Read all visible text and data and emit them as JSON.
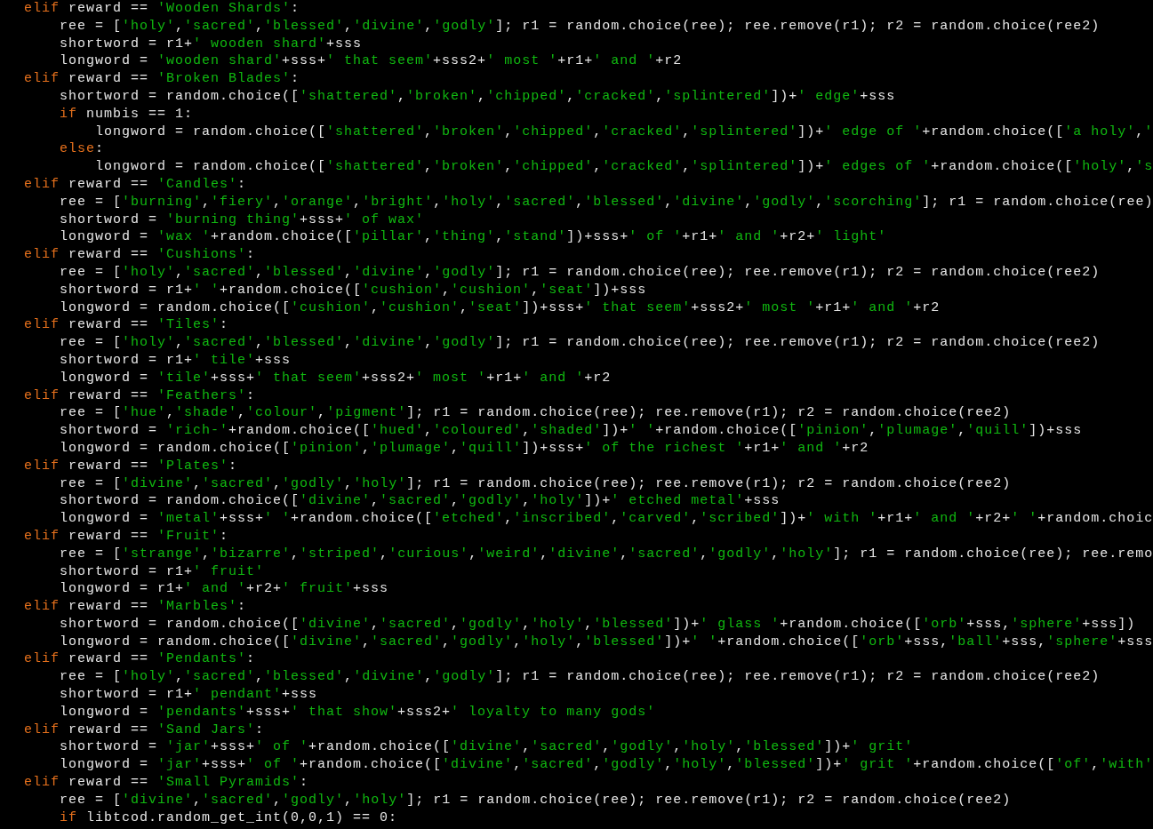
{
  "lines": [
    {
      "text": "elif reward == 'Wooden Shards':",
      "keyword": true
    },
    {
      "text": "    ree = ['holy','sacred','blessed','divine','godly']; r1 = random.choice(ree); ree.remove(r1); r2 = random.choice(ree2)",
      "keyword": false
    },
    {
      "text": "    shortword = r1+' wooden shard'+sss",
      "keyword": false
    },
    {
      "text": "    longword = 'wooden shard'+sss+' that seem'+sss2+' most '+r1+' and '+r2",
      "keyword": false
    },
    {
      "text": "elif reward == 'Broken Blades':",
      "keyword": true
    },
    {
      "text": "    shortword = random.choice(['shattered','broken','chipped','cracked','splintered'])+' edge'+sss",
      "keyword": false
    },
    {
      "text": "    if numbis == 1:",
      "keyword": true
    },
    {
      "text": "        longword = random.choice(['shattered','broken','chipped','cracked','splintered'])+' edge of '+random.choice(['a holy','",
      "keyword": false
    },
    {
      "text": "    else:",
      "keyword": true
    },
    {
      "text": "        longword = random.choice(['shattered','broken','chipped','cracked','splintered'])+' edges of '+random.choice(['holy','s",
      "keyword": false
    },
    {
      "text": "elif reward == 'Candles':",
      "keyword": true
    },
    {
      "text": "    ree = ['burning','fiery','orange','bright','holy','sacred','blessed','divine','godly','scorching']; r1 = random.choice(ree)",
      "keyword": false
    },
    {
      "text": "    shortword = 'burning thing'+sss+' of wax'",
      "keyword": false
    },
    {
      "text": "    longword = 'wax '+random.choice(['pillar','thing','stand'])+sss+' of '+r1+' and '+r2+' light'",
      "keyword": false
    },
    {
      "text": "elif reward == 'Cushions':",
      "keyword": true
    },
    {
      "text": "    ree = ['holy','sacred','blessed','divine','godly']; r1 = random.choice(ree); ree.remove(r1); r2 = random.choice(ree2)",
      "keyword": false
    },
    {
      "text": "    shortword = r1+' '+random.choice(['cushion','cushion','seat'])+sss",
      "keyword": false
    },
    {
      "text": "    longword = random.choice(['cushion','cushion','seat'])+sss+' that seem'+sss2+' most '+r1+' and '+r2",
      "keyword": false
    },
    {
      "text": "elif reward == 'Tiles':",
      "keyword": true
    },
    {
      "text": "    ree = ['holy','sacred','blessed','divine','godly']; r1 = random.choice(ree); ree.remove(r1); r2 = random.choice(ree2)",
      "keyword": false
    },
    {
      "text": "    shortword = r1+' tile'+sss",
      "keyword": false
    },
    {
      "text": "    longword = 'tile'+sss+' that seem'+sss2+' most '+r1+' and '+r2",
      "keyword": false
    },
    {
      "text": "elif reward == 'Feathers':",
      "keyword": true
    },
    {
      "text": "    ree = ['hue','shade','colour','pigment']; r1 = random.choice(ree); ree.remove(r1); r2 = random.choice(ree2)",
      "keyword": false
    },
    {
      "text": "    shortword = 'rich-'+random.choice(['hued','coloured','shaded'])+' '+random.choice(['pinion','plumage','quill'])+sss",
      "keyword": false
    },
    {
      "text": "    longword = random.choice(['pinion','plumage','quill'])+sss+' of the richest '+r1+' and '+r2",
      "keyword": false
    },
    {
      "text": "elif reward == 'Plates':",
      "keyword": true
    },
    {
      "text": "    ree = ['divine','sacred','godly','holy']; r1 = random.choice(ree); ree.remove(r1); r2 = random.choice(ree2)",
      "keyword": false
    },
    {
      "text": "    shortword = random.choice(['divine','sacred','godly','holy'])+' etched metal'+sss",
      "keyword": false
    },
    {
      "text": "    longword = 'metal'+sss+' '+random.choice(['etched','inscribed','carved','scribed'])+' with '+r1+' and '+r2+' '+random.choic",
      "keyword": false
    },
    {
      "text": "elif reward == 'Fruit':",
      "keyword": true
    },
    {
      "text": "    ree = ['strange','bizarre','striped','curious','weird','divine','sacred','godly','holy']; r1 = random.choice(ree); ree.remo",
      "keyword": false
    },
    {
      "text": "    shortword = r1+' fruit'",
      "keyword": false
    },
    {
      "text": "    longword = r1+' and '+r2+' fruit'+sss",
      "keyword": false
    },
    {
      "text": "elif reward == 'Marbles':",
      "keyword": true
    },
    {
      "text": "    shortword = random.choice(['divine','sacred','godly','holy','blessed'])+' glass '+random.choice(['orb'+sss,'sphere'+sss])",
      "keyword": false
    },
    {
      "text": "    longword = random.choice(['divine','sacred','godly','holy','blessed'])+' '+random.choice(['orb'+sss,'ball'+sss,'sphere'+sss",
      "keyword": false
    },
    {
      "text": "elif reward == 'Pendants':",
      "keyword": true
    },
    {
      "text": "    ree = ['holy','sacred','blessed','divine','godly']; r1 = random.choice(ree); ree.remove(r1); r2 = random.choice(ree2)",
      "keyword": false
    },
    {
      "text": "    shortword = r1+' pendant'+sss",
      "keyword": false
    },
    {
      "text": "    longword = 'pendants'+sss+' that show'+sss2+' loyalty to many gods'",
      "keyword": false
    },
    {
      "text": "elif reward == 'Sand Jars':",
      "keyword": true
    },
    {
      "text": "    shortword = 'jar'+sss+' of '+random.choice(['divine','sacred','godly','holy','blessed'])+' grit'",
      "keyword": false
    },
    {
      "text": "    longword = 'jar'+sss+' of '+random.choice(['divine','sacred','godly','holy','blessed'])+' grit '+random.choice(['of','with'",
      "keyword": false
    },
    {
      "text": "elif reward == 'Small Pyramids':",
      "keyword": true
    },
    {
      "text": "    ree = ['divine','sacred','godly','holy']; r1 = random.choice(ree); ree.remove(r1); r2 = random.choice(ree2)",
      "keyword": false
    },
    {
      "text": "    if libtcod.random_get_int(0,0,1) == 0:",
      "keyword": true
    }
  ]
}
